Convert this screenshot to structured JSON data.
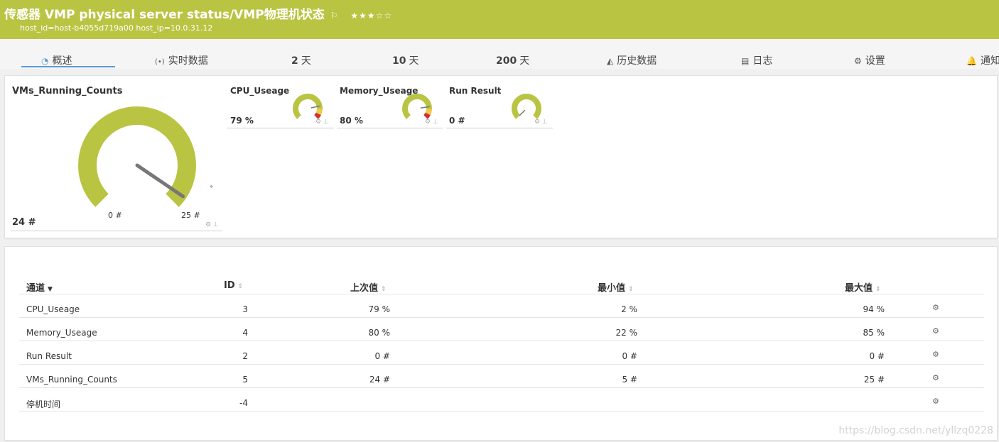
{
  "header": {
    "title": "传感器 VMP physical server status/VMP物理机状态",
    "flag": "⚐",
    "stars": "★★★☆☆",
    "subtitle": "host_id=host-b4055d719a00 host_ip=10.0.31.12",
    "color": "#b9c442"
  },
  "tabs": [
    {
      "label": "概述",
      "icon": "gauge-icon",
      "glyph": "◔"
    },
    {
      "label": "实时数据",
      "icon": "broadcast-icon",
      "glyph": "(•)"
    },
    {
      "num": "2",
      "unit": "天"
    },
    {
      "num": "10",
      "unit": "天"
    },
    {
      "num": "200",
      "unit": "天"
    },
    {
      "label": "历史数据",
      "icon": "area-chart-icon",
      "glyph": "◭"
    },
    {
      "label": "日志",
      "icon": "list-icon",
      "glyph": "▤"
    },
    {
      "label": "设置",
      "icon": "gear-icon",
      "glyph": "⚙"
    },
    {
      "label": "通知",
      "icon": "bell-icon",
      "glyph": "🔔"
    }
  ],
  "gauges": {
    "main": {
      "name": "VMs_Running_Counts",
      "value": "24 #",
      "min": "0 #",
      "max": "25 #",
      "level": 24,
      "range": 25
    },
    "cpu": {
      "name": "CPU_Useage",
      "value": "79 %",
      "level": 79
    },
    "memory": {
      "name": "Memory_Useage",
      "value": "80 %",
      "level": 80
    },
    "run": {
      "name": "Run Result",
      "value": "0 #",
      "level": 0
    }
  },
  "colors": {
    "gauge": "#b9c442",
    "warn": "#f2c94c",
    "danger": "#d0312d",
    "needle": "#777777"
  },
  "table": {
    "headers": {
      "channel": "通道",
      "id": "ID",
      "last": "上次值",
      "min": "最小值",
      "max": "最大值"
    },
    "rows": [
      {
        "name": "CPU_Useage",
        "id": "3",
        "last": "79 %",
        "min": "2 %",
        "max": "94 %"
      },
      {
        "name": "Memory_Useage",
        "id": "4",
        "last": "80 %",
        "min": "22 %",
        "max": "85 %"
      },
      {
        "name": "Run Result",
        "id": "2",
        "last": "0 #",
        "min": "0 #",
        "max": "0 #"
      },
      {
        "name": "VMs_Running_Counts",
        "id": "5",
        "last": "24 #",
        "min": "5 #",
        "max": "25 #"
      },
      {
        "name": "停机时间",
        "id": "-4",
        "last": "",
        "min": "",
        "max": ""
      }
    ]
  },
  "watermark": "https://blog.csdn.net/yllzq0228"
}
